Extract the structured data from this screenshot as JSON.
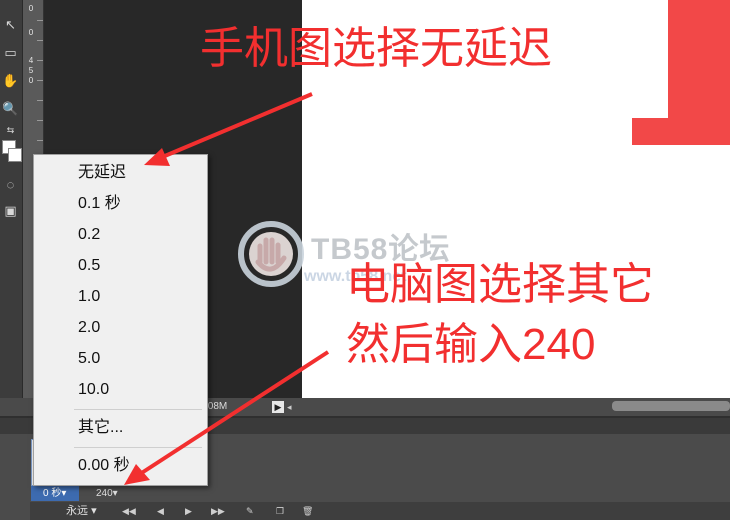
{
  "ruler": {
    "labels": [
      "0",
      "0",
      "4",
      "5",
      "0"
    ]
  },
  "toolbar": {
    "icons": [
      "move-arrow-icon",
      "marquee-icon",
      "hand-icon",
      "zoom-icon",
      "swap-colors-icon",
      "color-swatches-icon",
      "quick-mask-icon",
      "screen-mode-icon"
    ]
  },
  "status": {
    "doc_size": ".08M",
    "arrow": "▶",
    "arrow_small": "◂"
  },
  "menu": {
    "items": [
      {
        "label": "无延迟"
      },
      {
        "label": "0.1 秒"
      },
      {
        "label": "0.2"
      },
      {
        "label": "0.5"
      },
      {
        "label": "1.0"
      },
      {
        "label": "2.0"
      },
      {
        "label": "5.0"
      },
      {
        "label": "10.0"
      },
      {
        "label": "其它..."
      },
      {
        "label": "0.00 秒"
      }
    ]
  },
  "timeline": {
    "delay1": "0 秒▾",
    "delay2": "240▾",
    "loop": "永远",
    "loop_arrow": "▾",
    "controls": {
      "first": "◀◀",
      "prev": "◀",
      "play": "▶",
      "next": "▶▶",
      "tween": "✎",
      "new": "❐",
      "delete": "🗑"
    }
  },
  "annotations": {
    "phone": "手机图选择无延迟",
    "pc_line1": "电脑图选择其它",
    "pc_line2": "然后输入240"
  },
  "watermark": {
    "text": "TB58论坛",
    "url": "www.tb58.net"
  },
  "colors": {
    "annotation": "#f22f2f",
    "red_bar": "#f24848",
    "selected_field": "#3d6bb0"
  }
}
